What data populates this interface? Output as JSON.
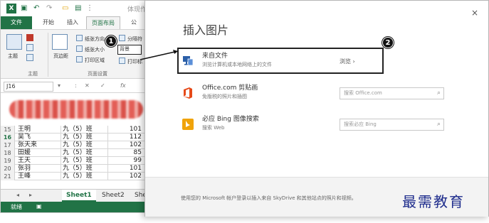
{
  "excel": {
    "title_doc": "体现作词",
    "tabs": [
      "文件",
      "开始",
      "插入",
      "页面布局",
      "公"
    ],
    "ribbon": {
      "theme_label": "主题",
      "margins_label": "页边距",
      "size_label": "纸张方向",
      "paper_size_label": "纸张大小",
      "print_area_label": "打印区域",
      "breaks_label": "分隔符",
      "background_label": "背景",
      "print_titles_label": "打印标",
      "group_theme": "主题",
      "group_page_setup": "页面设置"
    },
    "name_box": "J16",
    "formula_symbols": [
      "▾",
      ":",
      "✕",
      "✓",
      "fx"
    ],
    "rows": [
      {
        "num": "15",
        "name": "王明",
        "cls": "九（5）班",
        "score": "101"
      },
      {
        "num": "16",
        "name": "吴飞",
        "cls": "九（5）班",
        "score": "112"
      },
      {
        "num": "17",
        "name": "张天来",
        "cls": "九（5）班",
        "score": "102"
      },
      {
        "num": "18",
        "name": "田媛",
        "cls": "九（5）班",
        "score": "85"
      },
      {
        "num": "19",
        "name": "王天",
        "cls": "九（5）班",
        "score": "99"
      },
      {
        "num": "20",
        "name": "张羽",
        "cls": "九（5）班",
        "score": "101"
      },
      {
        "num": "21",
        "name": "王峰",
        "cls": "九（5）班",
        "score": "102"
      }
    ],
    "sheets": [
      "Sheet1",
      "Sheet2",
      "She"
    ],
    "status": "就绪"
  },
  "badges": {
    "one": "1",
    "two": "2"
  },
  "dialog": {
    "close": "×",
    "title": "插入图片",
    "options": [
      {
        "title": "来自文件",
        "desc": "浏览计算机或本地网络上的文件",
        "action": "浏览 ›"
      },
      {
        "title": "Office.com 剪贴画",
        "desc": "免版税的照片和插图",
        "placeholder": "搜索 Office.com"
      },
      {
        "title": "必应 Bing 图像搜索",
        "desc": "搜索 Web",
        "placeholder": "搜索必应 Bing"
      }
    ],
    "footer_note": "使用您的 Microsoft 帐户登录以插入来自 SkyDrive 和其他站点的照片和视频。"
  },
  "watermark": "最需教育",
  "colors": {
    "excel_green": "#217346",
    "office_red": "#e64a19",
    "bing_orange": "#f0a30a",
    "watermark_blue": "#1e2c8c"
  }
}
